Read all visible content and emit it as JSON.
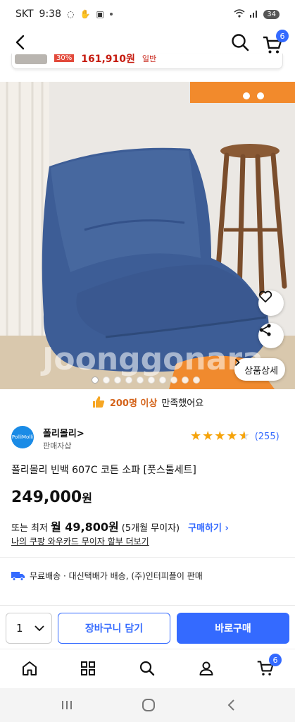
{
  "status_bar": {
    "carrier": "SKT",
    "time": "9:38",
    "battery": "34"
  },
  "nav": {
    "cart_count": "6"
  },
  "sticky_strip": {
    "discount": "30%",
    "price": "161,910원",
    "suffix": "일반"
  },
  "gallery": {
    "watermark": "Joonggonara",
    "detail_button": "상품상세",
    "dot_count": 10,
    "active_dot": 0
  },
  "satisfaction": {
    "count": "200명 이상",
    "text": "만족했어요"
  },
  "seller": {
    "logo_text": "PolliMolli",
    "name": "폴리몰리>",
    "type": "판매자샵",
    "rating_count": "(255)",
    "rating": 4.5
  },
  "product": {
    "title": "폴리몰리 빈백 607C 코튼 소파 [풋스툴세트]",
    "price": "249,000",
    "price_unit": "원"
  },
  "installment": {
    "prefix": "또는 최저",
    "monthly": "월 49,800원",
    "detail": "(5개월 무이자)",
    "buy_link": "구매하기 ›"
  },
  "card_link": "나의 쿠팡 와우카드 무이자 할부 더보기",
  "shipping": {
    "text": "무료배송 · 대신택배가 배송, (주)인터피플이 판매"
  },
  "actions": {
    "quantity": "1",
    "add_to_cart": "장바구니 담기",
    "buy_now": "바로구매"
  },
  "tab_bar": {
    "cart_count": "6"
  },
  "colors": {
    "accent": "#346aff",
    "sale_red": "#c61c10",
    "star": "#f5a30a",
    "sofa": "#3d5d96"
  }
}
